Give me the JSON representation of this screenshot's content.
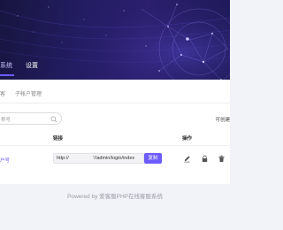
{
  "nav": {
    "tabs": [
      {
        "label": "系统",
        "active": true
      },
      {
        "label": "设置",
        "active": false
      }
    ]
  },
  "subtabs": [
    "客",
    "子帐户管理"
  ],
  "search": {
    "placeholder": "称号"
  },
  "toolbar": {
    "right_label": "可创建"
  },
  "table": {
    "headers": {
      "link": "链接",
      "actions": "操作"
    },
    "rows": [
      {
        "name": "户号",
        "url": "http://          '//admin/login/index",
        "copy_label": "复制"
      }
    ]
  },
  "icons": [
    "edit-icon",
    "lock-icon",
    "delete-icon"
  ],
  "colors": {
    "accent": "#6c5cff",
    "hero_dark": "#17153f",
    "hero_mid": "#2b1f6e",
    "background": "#f2f3f8"
  },
  "footer": {
    "text": "Powered by 爱客服PHP在线客服系统"
  }
}
